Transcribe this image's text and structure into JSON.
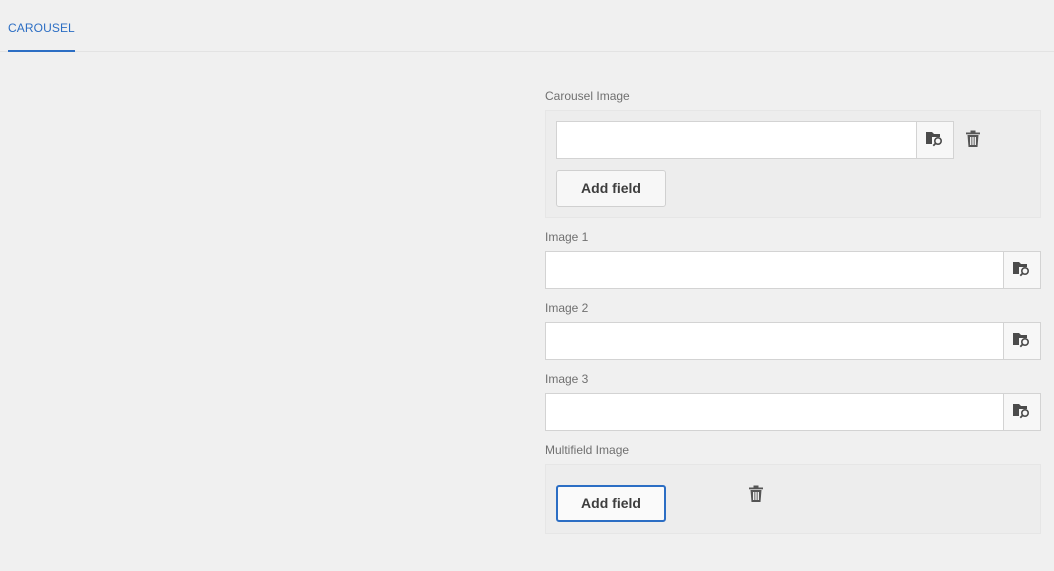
{
  "tabs": [
    {
      "label": "CAROUSEL",
      "active": true
    }
  ],
  "carousel_image": {
    "label": "Carousel Image",
    "value": "",
    "add_label": "Add field"
  },
  "image1": {
    "label": "Image 1",
    "value": ""
  },
  "image2": {
    "label": "Image 2",
    "value": ""
  },
  "image3": {
    "label": "Image 3",
    "value": ""
  },
  "multifield_image": {
    "label": "Multifield Image",
    "add_label": "Add field"
  },
  "icons": {
    "browse": "folder-search-icon",
    "delete": "trash-icon"
  },
  "colors": {
    "accent": "#2c6ec4",
    "background": "#f0f0f0",
    "panel": "#ededed"
  }
}
